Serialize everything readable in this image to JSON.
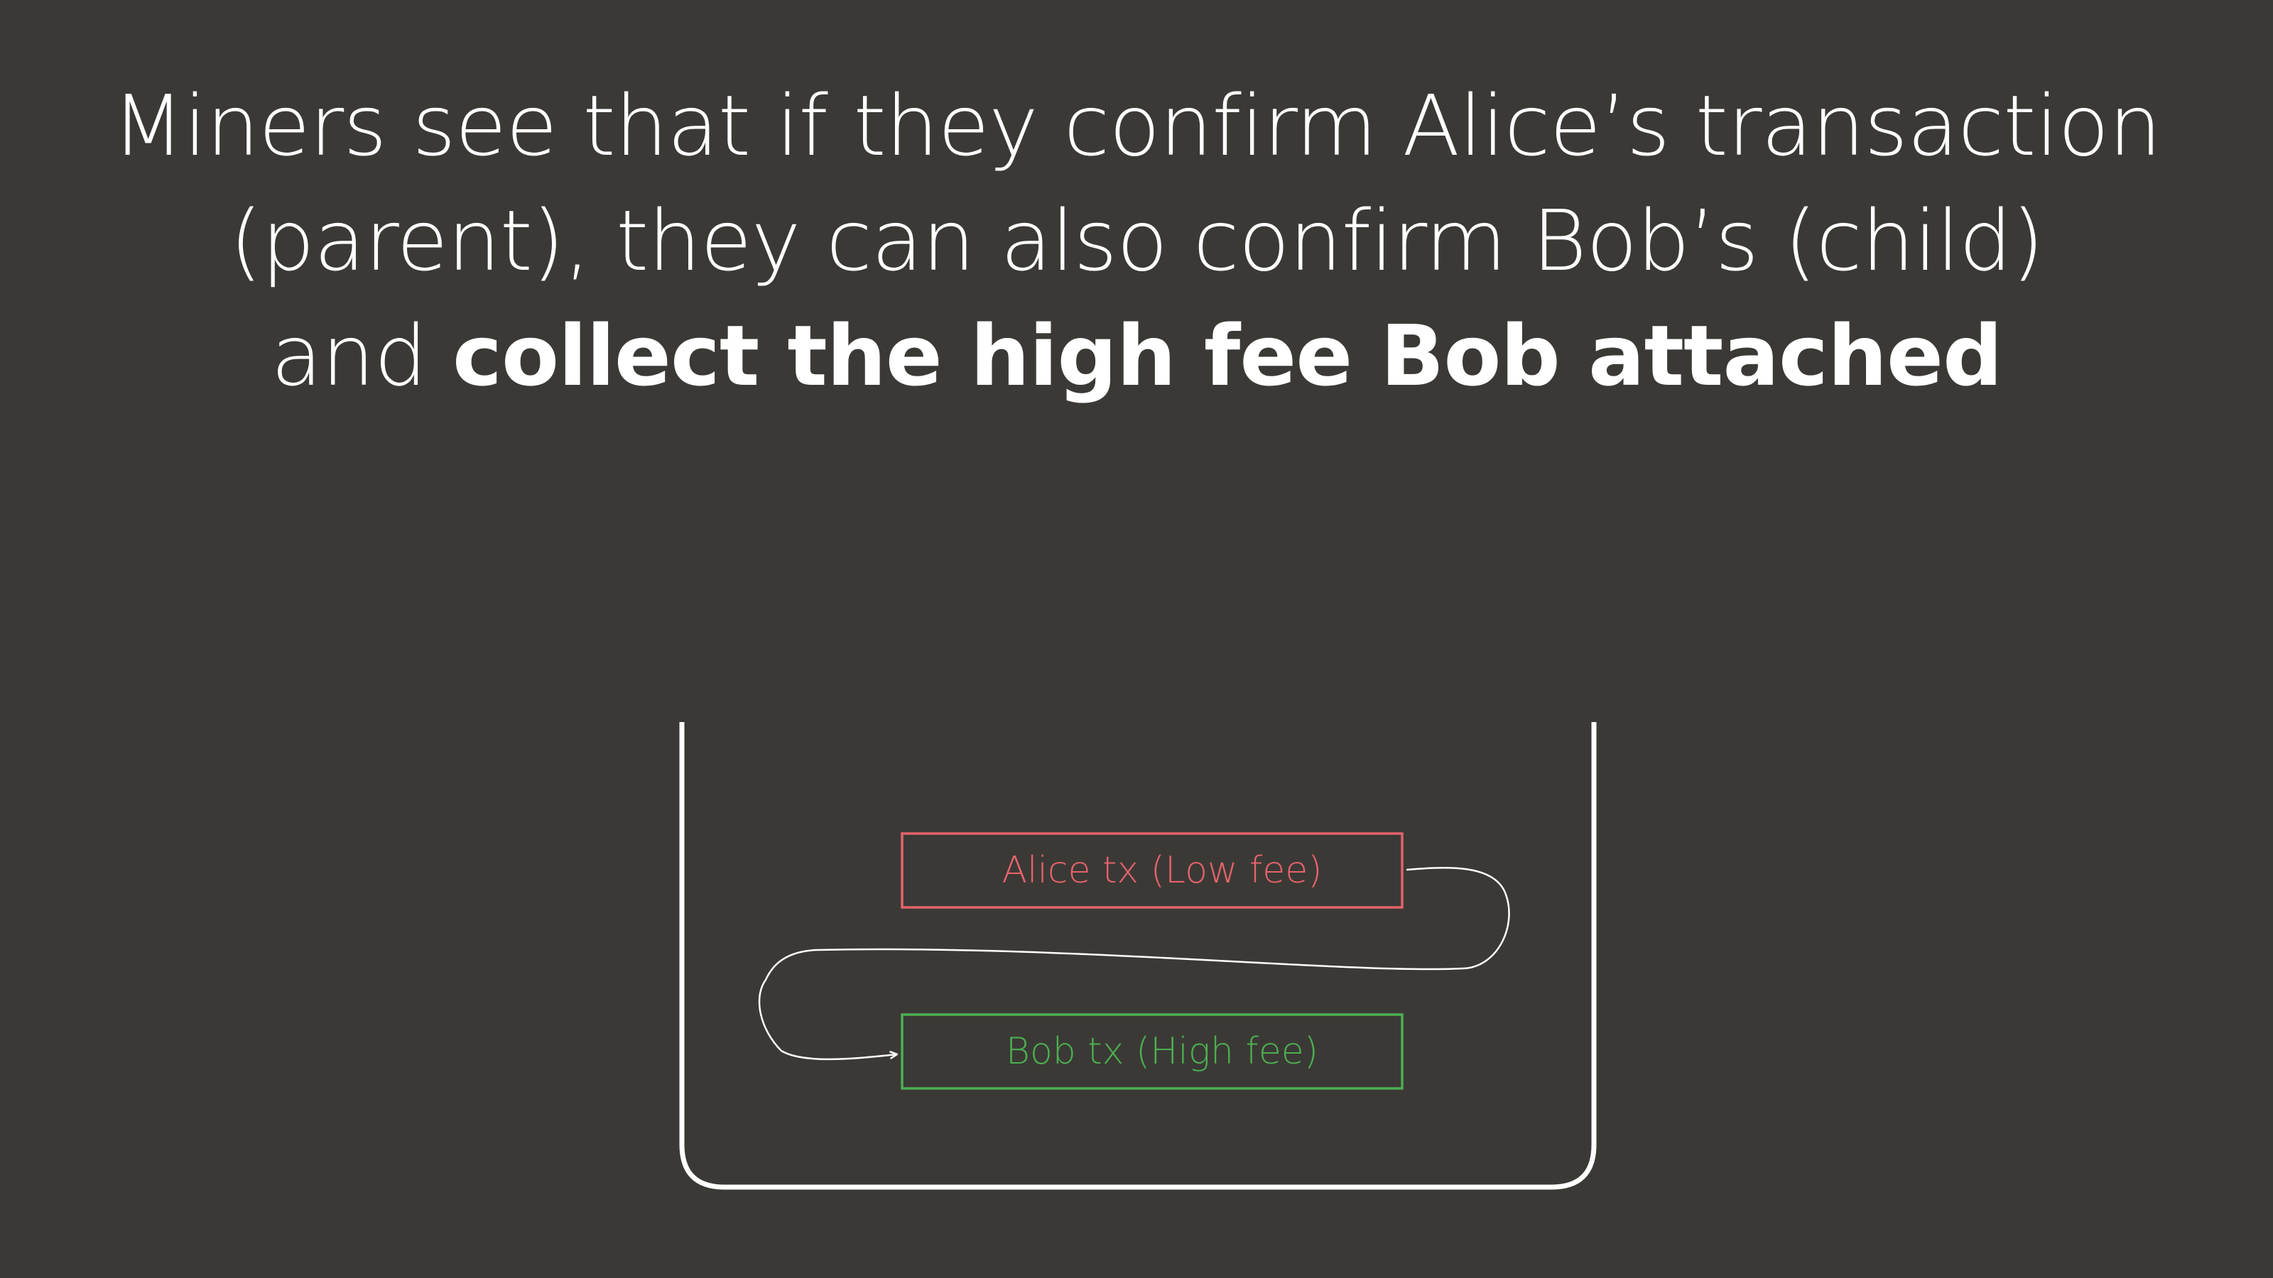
{
  "heading": {
    "line1": "Miners see that if they confirm Alice’s transaction",
    "line2": "(parent), they can also confirm Bob’s (child)",
    "line3_plain": "and ",
    "line3_bold": "collect the high fee Bob attached"
  },
  "diagram": {
    "parent_tx": {
      "label": "Alice tx (Low fee)",
      "color": "#e5636a"
    },
    "child_tx": {
      "label": "Bob tx (High fee)",
      "color": "#4caf50"
    },
    "container_color": "#ffffff",
    "arrow_color": "#ffffff"
  },
  "colors": {
    "background": "#3b3936",
    "text": "#ffffff"
  }
}
